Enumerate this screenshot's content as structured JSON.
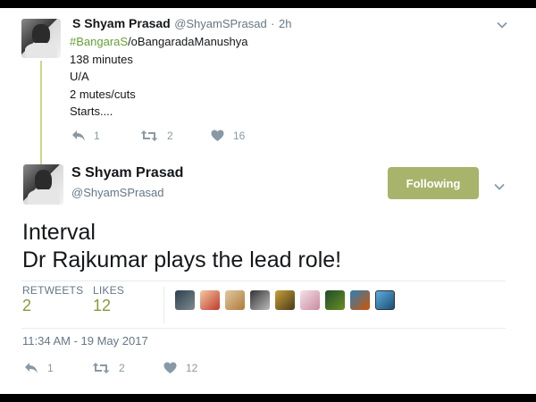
{
  "tweet1": {
    "name": "S Shyam Prasad",
    "handle": "@ShyamSPrasad",
    "separator": "·",
    "time": "2h",
    "hashtag": "#BangaraS",
    "hashtag_rest": "/oBangaradaManushya",
    "lines": [
      "138 minutes",
      "U/A",
      "2 mutes/cuts",
      "Starts...."
    ],
    "reply_count": "1",
    "retweet_count": "2",
    "like_count": "16"
  },
  "tweet2": {
    "name": "S Shyam Prasad",
    "handle": "@ShyamSPrasad",
    "follow_label": "Following",
    "text_line1": "Interval",
    "text_line2": "Dr Rajkumar plays the lead role!",
    "retweets_label": "RETWEETS",
    "retweets_value": "2",
    "likes_label": "LIKES",
    "likes_value": "12",
    "timestamp": "11:34 AM - 19 May 2017",
    "reply_count": "1",
    "retweet_count": "2",
    "like_count": "12"
  },
  "icons": {
    "reply": "reply-icon",
    "retweet": "retweet-icon",
    "like": "heart-icon",
    "more": "chevron-down-icon"
  },
  "colors": {
    "follow_button": "#a8b36b",
    "hashtag": "#689f38",
    "stat_value": "#8a9a3a",
    "thread_line": "#c7d88a"
  }
}
